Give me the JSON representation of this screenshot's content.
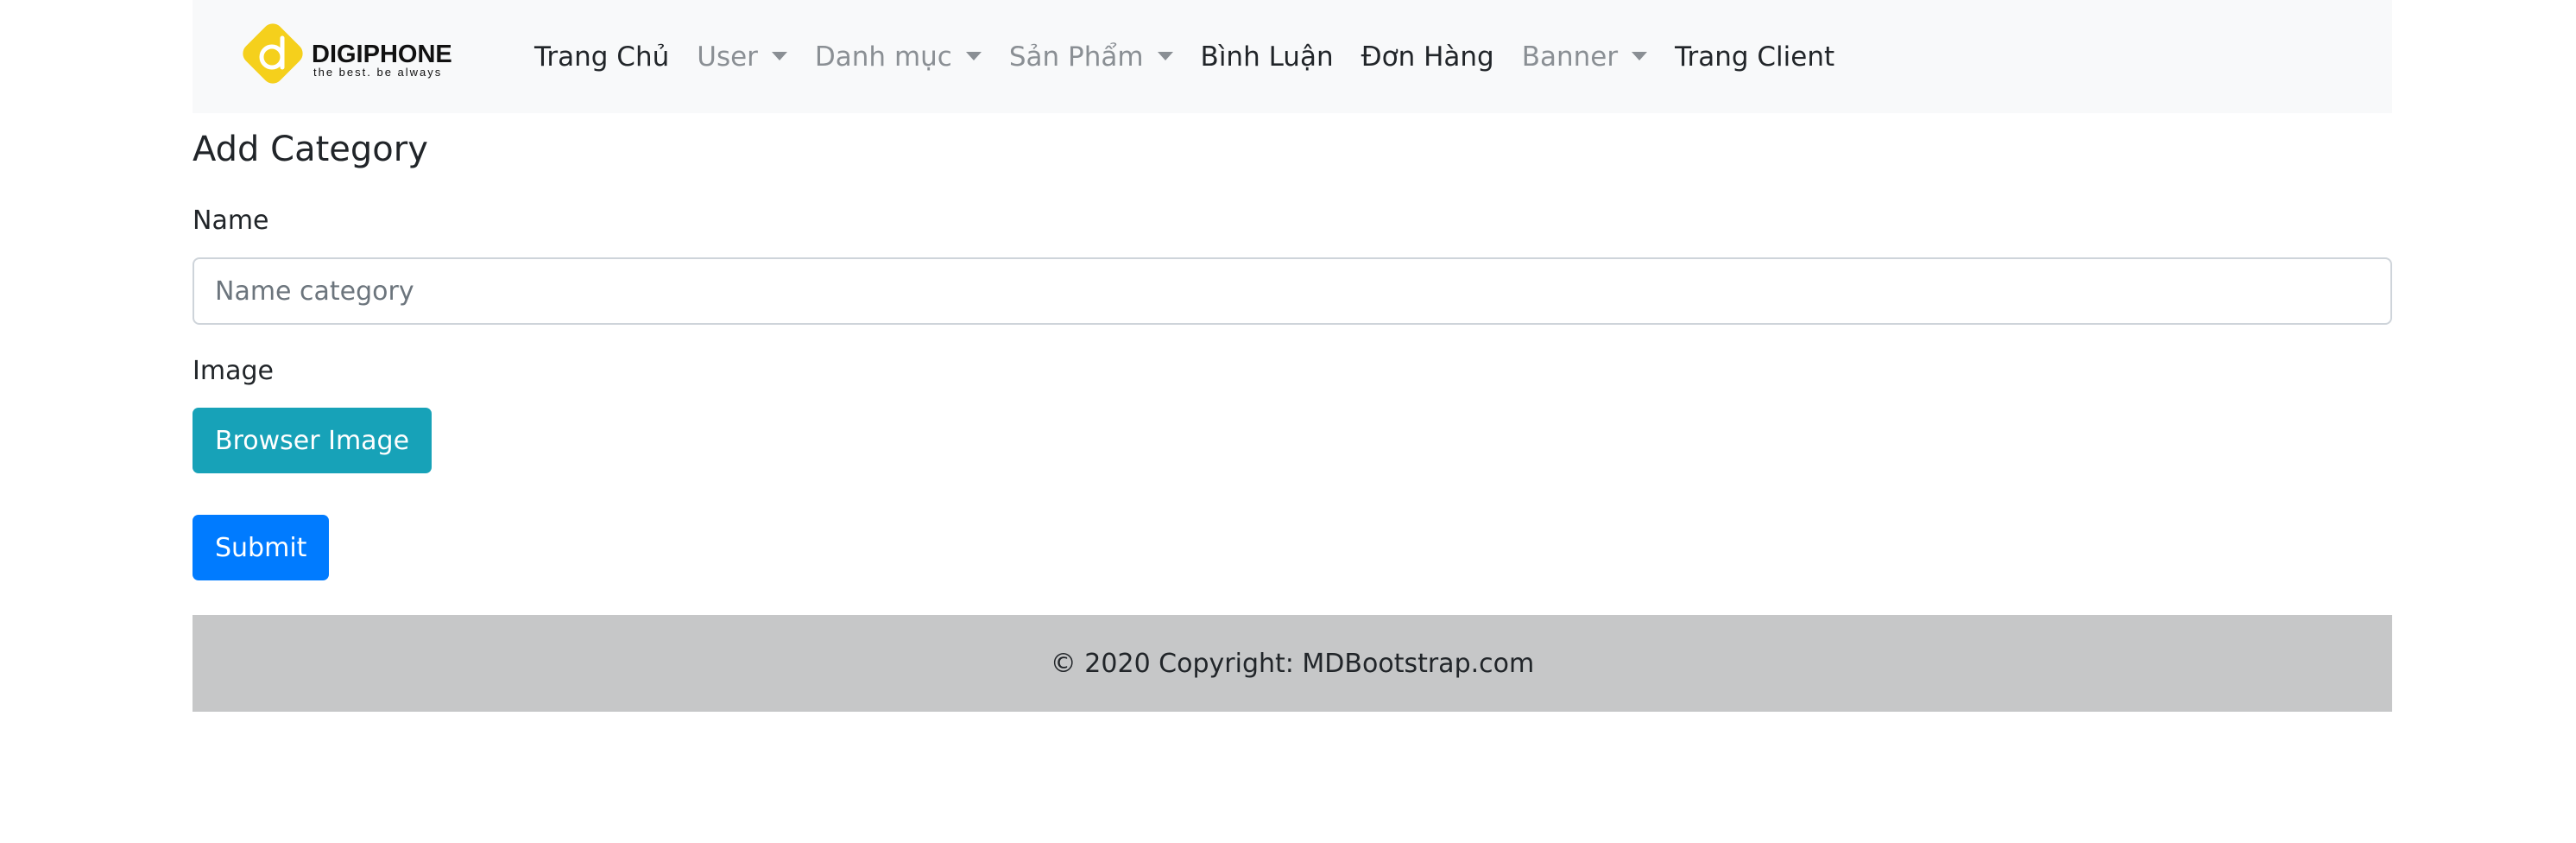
{
  "navbar": {
    "brand": {
      "name": "DIGIPHONE",
      "tagline": "the best. be always"
    },
    "items": [
      {
        "label": "Trang Chủ",
        "dropdown": false,
        "active": true
      },
      {
        "label": "User",
        "dropdown": true,
        "active": false
      },
      {
        "label": "Danh mục",
        "dropdown": true,
        "active": false
      },
      {
        "label": "Sản Phẩm",
        "dropdown": true,
        "active": false
      },
      {
        "label": "Bình Luận",
        "dropdown": false,
        "active": true
      },
      {
        "label": "Đơn Hàng",
        "dropdown": false,
        "active": true
      },
      {
        "label": "Banner",
        "dropdown": true,
        "active": false
      },
      {
        "label": "Trang Client",
        "dropdown": false,
        "active": true
      }
    ]
  },
  "form": {
    "title": "Add Category",
    "name_label": "Name",
    "name_placeholder": "Name category",
    "name_value": "",
    "image_label": "Image",
    "browse_button": "Browser Image",
    "submit_button": "Submit"
  },
  "footer": {
    "text": "© 2020 Copyright: MDBootstrap.com"
  },
  "colors": {
    "navbar_bg": "#f8f9fa",
    "logo_yellow": "#f5d01c",
    "info_button": "#17a2b8",
    "primary_button": "#007bff",
    "footer_bg": "#c6c7c8",
    "muted_text": "#8a8f94"
  }
}
